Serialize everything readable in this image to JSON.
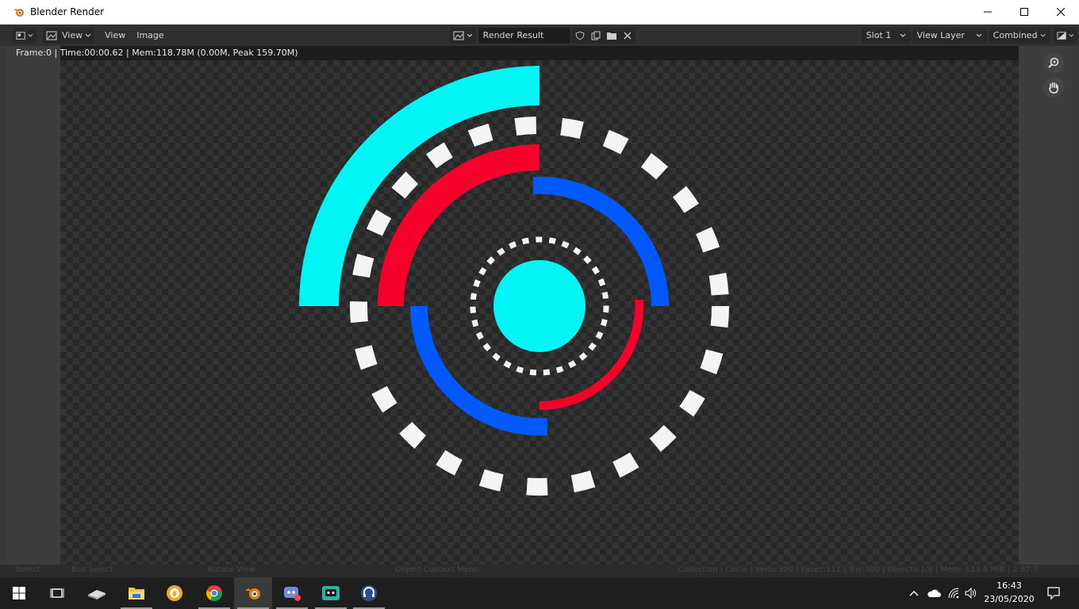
{
  "window": {
    "title": "Blender Render"
  },
  "header": {
    "menus": [
      "View",
      "View",
      "Image"
    ],
    "image_name": "Render Result",
    "slot": "Slot 1",
    "view_layer": "View Layer",
    "pass": "Combined"
  },
  "info": {
    "line": "Frame:0 | Time:00:00.62 | Mem:118.78M (0.00M, Peak 159.70M)"
  },
  "statusbar": {
    "items": [
      "Select",
      "Box Select",
      "Rotate View",
      "Object Context Menu"
    ],
    "stats": "Collection | Circle | Verts:300 | Faces:111 | Tris:300 | Objects:1/8 | Mem: 113.8 MiB | 2.82.7"
  },
  "taskbar": {
    "apps": [
      "start-icon",
      "task-view-icon",
      "edge-like-icon",
      "file-explorer-icon",
      "brave-icon",
      "chrome-icon",
      "blender-icon",
      "discord-icon",
      "chat-app-icon",
      "headset-app-icon"
    ],
    "time": "16:43",
    "date": "23/05/2020"
  },
  "colors": {
    "cyan": "#00f5f5",
    "red": "#f5002a",
    "blue": "#0058ff",
    "white": "#f4f4f4",
    "ui_dark": "#303030"
  }
}
